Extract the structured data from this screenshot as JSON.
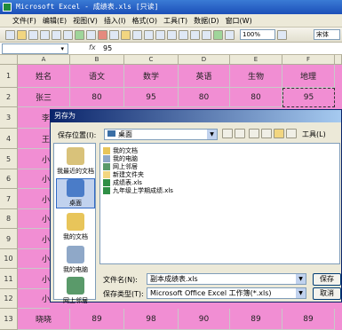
{
  "window": {
    "title": "Microsoft Excel - 成绩表.xls  [只读]"
  },
  "menu": [
    "文件(F)",
    "编辑(E)",
    "视图(V)",
    "插入(I)",
    "格式(O)",
    "工具(T)",
    "数据(D)",
    "窗口(W)"
  ],
  "toolbar": {
    "zoom": "100%",
    "font": "宋体"
  },
  "formula": {
    "fx": "fx",
    "value": "95"
  },
  "columns": [
    "A",
    "B",
    "C",
    "D",
    "E",
    "F"
  ],
  "rows": [
    "1",
    "2",
    "3",
    "4",
    "5",
    "6",
    "7",
    "8",
    "9",
    "10",
    "11",
    "12",
    "13"
  ],
  "cells": {
    "r1": [
      "姓名",
      "语文",
      "数学",
      "英语",
      "生物",
      "地理"
    ],
    "r2": [
      "张三",
      "80",
      "95",
      "80",
      "80",
      "95"
    ],
    "r3": [
      "李"
    ],
    "r4": [
      "王"
    ],
    "r5": [
      "小"
    ],
    "r6": [
      "小"
    ],
    "r7": [
      "小"
    ],
    "r8": [
      "小"
    ],
    "r9": [
      "小"
    ],
    "r10": [
      "小"
    ],
    "r11": [
      "小"
    ],
    "r12": [
      "小"
    ],
    "r13": [
      "晓晓",
      "89",
      "98",
      "90",
      "89",
      "89"
    ]
  },
  "dialog": {
    "title": "另存为",
    "save_in_label": "保存位置(I):",
    "save_in_value": "桌面",
    "tools_label": "工具(L)",
    "places": [
      "我最近的文档",
      "桌面",
      "我的文档",
      "我的电脑",
      "网上邻居"
    ],
    "files": [
      "我的文档",
      "我的电脑",
      "网上邻居",
      "新建文件夹",
      "成绩表.xls",
      "九年级上学期成绩.xls"
    ],
    "filename_label": "文件名(N):",
    "filename_value": "副本成绩表.xls",
    "filetype_label": "保存类型(T):",
    "filetype_value": "Microsoft Office Excel 工作簿(*.xls)",
    "save_button": "保存",
    "cancel_button": "取消"
  }
}
